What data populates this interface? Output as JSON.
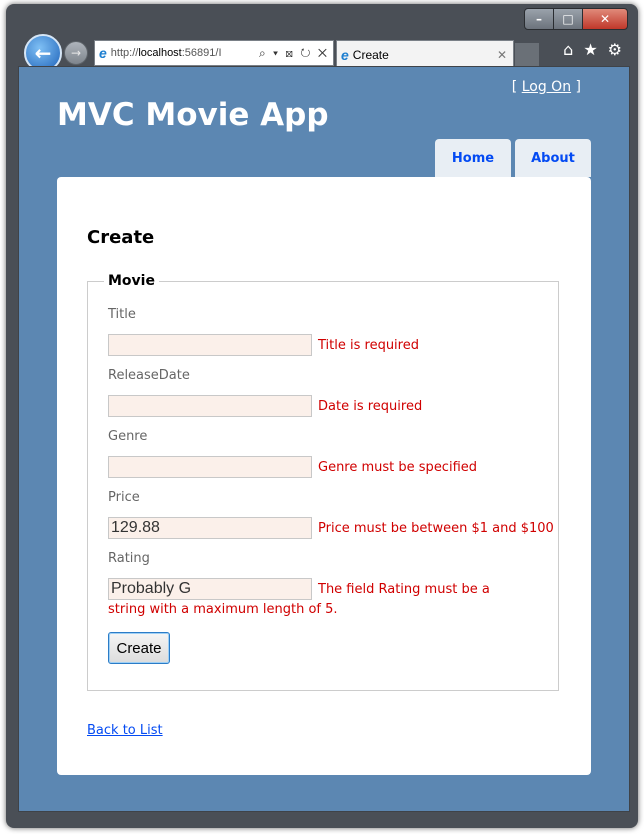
{
  "browser": {
    "titlebar": {
      "minimize": "–",
      "maximize": "□",
      "close": "✕"
    },
    "address_scheme": "http://",
    "address_host": "localhost",
    "address_rest": ":56891/I",
    "address_tools": "⌕ ▾ ⊠ ↻ ✕",
    "tab_title": "Create",
    "icons": [
      "back-icon",
      "forward-icon",
      "ie-icon",
      "home-icon",
      "favorites-icon",
      "tools-icon"
    ]
  },
  "header": {
    "login_open": "[ ",
    "login_link": "Log On",
    "login_close": " ]",
    "app_title": "MVC Movie App",
    "menu": [
      {
        "label": "Home"
      },
      {
        "label": "About"
      }
    ]
  },
  "page": {
    "heading": "Create",
    "fieldset_legend": "Movie",
    "fields": [
      {
        "label": "Title",
        "value": "",
        "error": "Title is required"
      },
      {
        "label": "ReleaseDate",
        "value": "",
        "error": "Date is required"
      },
      {
        "label": "Genre",
        "value": "",
        "error": "Genre must be specified"
      },
      {
        "label": "Price",
        "value": "129.88",
        "error": "Price must be between $1 and $100"
      },
      {
        "label": "Rating",
        "value": "Probably G",
        "error": "The field Rating must be a string with a maximum length of 5."
      }
    ],
    "submit_label": "Create",
    "back_link": "Back to List"
  },
  "colors": {
    "header_bg": "#5c87b2",
    "error": "#d00000",
    "input_bg": "#fbf0ea",
    "link": "#034af3"
  }
}
